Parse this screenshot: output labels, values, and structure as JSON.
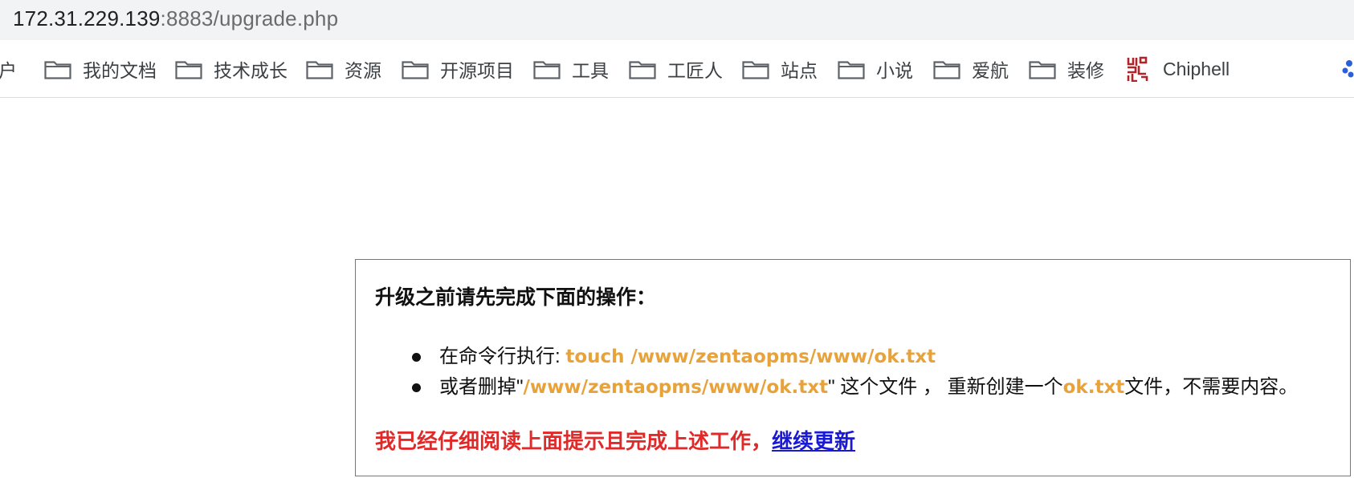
{
  "address_bar": {
    "host": "172.31.229.139",
    "rest": ":8883/upgrade.php"
  },
  "bookmarks": [
    {
      "label": "户",
      "icon": "user-partial-icon"
    },
    {
      "label": "我的文档",
      "icon": "folder-icon"
    },
    {
      "label": "技术成长",
      "icon": "folder-icon"
    },
    {
      "label": "资源",
      "icon": "folder-icon"
    },
    {
      "label": "开源项目",
      "icon": "folder-icon"
    },
    {
      "label": "工具",
      "icon": "folder-icon"
    },
    {
      "label": "工匠人",
      "icon": "folder-icon"
    },
    {
      "label": "站点",
      "icon": "folder-icon"
    },
    {
      "label": "小说",
      "icon": "folder-icon"
    },
    {
      "label": "爱航",
      "icon": "folder-icon"
    },
    {
      "label": "装修",
      "icon": "folder-icon"
    },
    {
      "label": "Chiphell",
      "icon": "chiphell-icon"
    }
  ],
  "panel": {
    "title": "升级之前请先完成下面的操作：",
    "items": [
      {
        "prefix": "在命令行执行: ",
        "command": "touch /www/zentaopms/www/ok.txt"
      },
      {
        "prefix": "或者删掉\"",
        "path": "/www/zentaopms/www/ok.txt",
        "middle": "\" 这个文件 ， 重新创建一个",
        "file": "ok.txt",
        "suffix": "文件，不需要内容。"
      }
    ],
    "confirm_text": "我已经仔细阅读上面提示且完成上述工作，",
    "continue_link": "继续更新"
  },
  "colors": {
    "highlight": "#e8a23a",
    "warning": "#e02a2a",
    "link": "#1a1ad6"
  }
}
